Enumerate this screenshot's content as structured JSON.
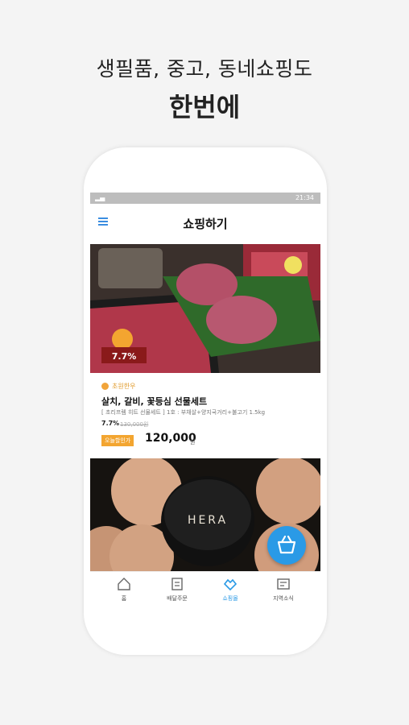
{
  "headline": {
    "sub": "생필품, 중고, 동네쇼핑도",
    "main": "한번에"
  },
  "status_bar": {
    "time": "21:34"
  },
  "app_bar": {
    "title": "쇼핑하기"
  },
  "product": {
    "badge_overlay": "7.7%",
    "brand": "초원한우",
    "name": "살치, 갈비, 꽃등심 선물세트",
    "description": "[ 초리프렘 히트 선물세트 ] 1호 : 부채살+양지국거리+불고기 1.5kg",
    "discount": "7.7%",
    "original_price": "130,000원",
    "badge": "오늘할인가",
    "price": "120,000",
    "currency": "원"
  },
  "product2": {
    "brand_mark": "HERA"
  },
  "fab": {
    "icon": "basket-icon"
  },
  "bottom_nav": {
    "tabs": [
      {
        "label": "홈",
        "icon": "home-icon"
      },
      {
        "label": "배달주문",
        "icon": "delivery-icon"
      },
      {
        "label": "쇼핑몰",
        "icon": "shop-icon"
      },
      {
        "label": "지역소식",
        "icon": "news-icon"
      }
    ]
  },
  "colors": {
    "accent": "#2a9ae6",
    "badge": "#f3a530",
    "brand_text": "#e09a2a"
  }
}
